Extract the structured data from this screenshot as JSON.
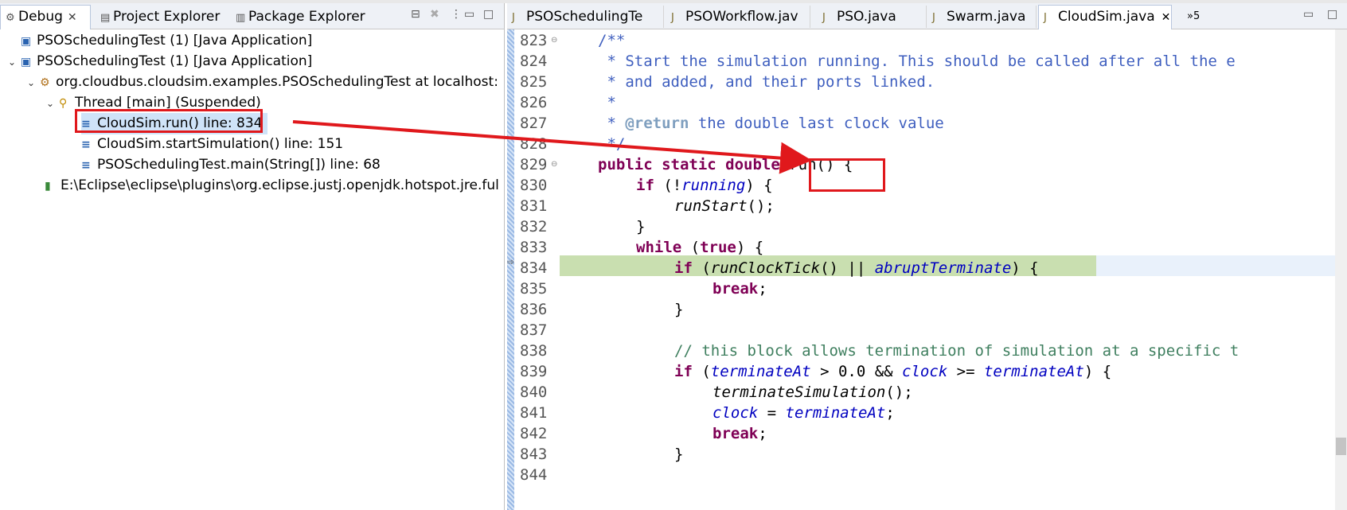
{
  "left_tabs": [
    {
      "label": "Debug",
      "icon": "debug-icon",
      "close": "✕"
    },
    {
      "label": "Project Explorer",
      "icon": "project-explorer-icon"
    },
    {
      "label": "Package Explorer",
      "icon": "package-explorer-icon"
    }
  ],
  "debug_tree": [
    {
      "label": "PSOSchedulingTest (1) [Java Application]",
      "icon": "java-app-icon"
    },
    {
      "label": "PSOSchedulingTest (1) [Java Application]",
      "icon": "java-app-icon"
    },
    {
      "label": "org.cloudbus.cloudsim.examples.PSOSchedulingTest at localhost:",
      "icon": "debug-target-icon"
    },
    {
      "label": "Thread [main] (Suspended)",
      "icon": "thread-suspended-icon"
    },
    {
      "label": "CloudSim.run() line: 834",
      "icon": "stack-frame-icon"
    },
    {
      "label": "CloudSim.startSimulation() line: 151",
      "icon": "stack-frame-icon"
    },
    {
      "label": "PSOSchedulingTest.main(String[]) line: 68",
      "icon": "stack-frame-icon"
    },
    {
      "label": "E:\\Eclipse\\eclipse\\plugins\\org.eclipse.justj.openjdk.hotspot.jre.ful",
      "icon": "process-icon"
    }
  ],
  "editor_tabs": [
    {
      "label": "PSOSchedulingTe",
      "icon": "java-file-icon"
    },
    {
      "label": "PSOWorkflow.jav",
      "icon": "java-file-icon"
    },
    {
      "label": "PSO.java",
      "icon": "java-file-icon"
    },
    {
      "label": "Swarm.java",
      "icon": "java-file-icon"
    },
    {
      "label": "CloudSim.java",
      "icon": "java-file-icon",
      "close": "✕"
    }
  ],
  "overflow_tabs": "»5",
  "line_numbers": [
    "823",
    "824",
    "825",
    "826",
    "827",
    "828",
    "829",
    "830",
    "831",
    "832",
    "833",
    "834",
    "835",
    "836",
    "837",
    "838",
    "839",
    "840",
    "841",
    "842",
    "843",
    "844"
  ],
  "code": {
    "l823": "/**",
    "l824": " * Start the simulation running. This should be called after all the e",
    "l825": " * and added, and their ports linked.",
    "l826": " *",
    "l827_star": " * ",
    "l827_tag": "@return",
    "l827_rest": " the double last clock value",
    "l828": " */",
    "l829_kw": "public static double",
    "l829_rest": " run() {",
    "l830_kw": "if",
    "l830_a": " (!",
    "l830_fld": "running",
    "l830_b": ") {",
    "l831_m": "runStart",
    "l831_b": "();",
    "l832": "}",
    "l833_kw": "while",
    "l833_a": " (",
    "l833_kw2": "true",
    "l833_b": ") {",
    "l834_kw": "if",
    "l834_a": " (",
    "l834_m": "runClockTick",
    "l834_b": "() || ",
    "l834_fld": "abruptTerminate",
    "l834_c": ") {",
    "l835_kw": "break",
    "l835_b": ";",
    "l836": "}",
    "l838": "// this block allows termination of simulation at a specific t",
    "l839_kw": "if",
    "l839_a": " (",
    "l839_f1": "terminateAt",
    "l839_b": " > 0.0 && ",
    "l839_f2": "clock",
    "l839_c": " >= ",
    "l839_f3": "terminateAt",
    "l839_d": ") {",
    "l840_m": "terminateSimulation",
    "l840_b": "();",
    "l841_f1": "clock",
    "l841_b": " = ",
    "l841_f2": "terminateAt",
    "l841_c": ";",
    "l842_kw": "break",
    "l842_b": ";",
    "l843": "}"
  },
  "colors": {
    "keyword": "#7f0055",
    "comment": "#3f5fbf",
    "field": "#0000c0",
    "highlight": "#c9dfb0",
    "annotation": "#e0181c"
  }
}
